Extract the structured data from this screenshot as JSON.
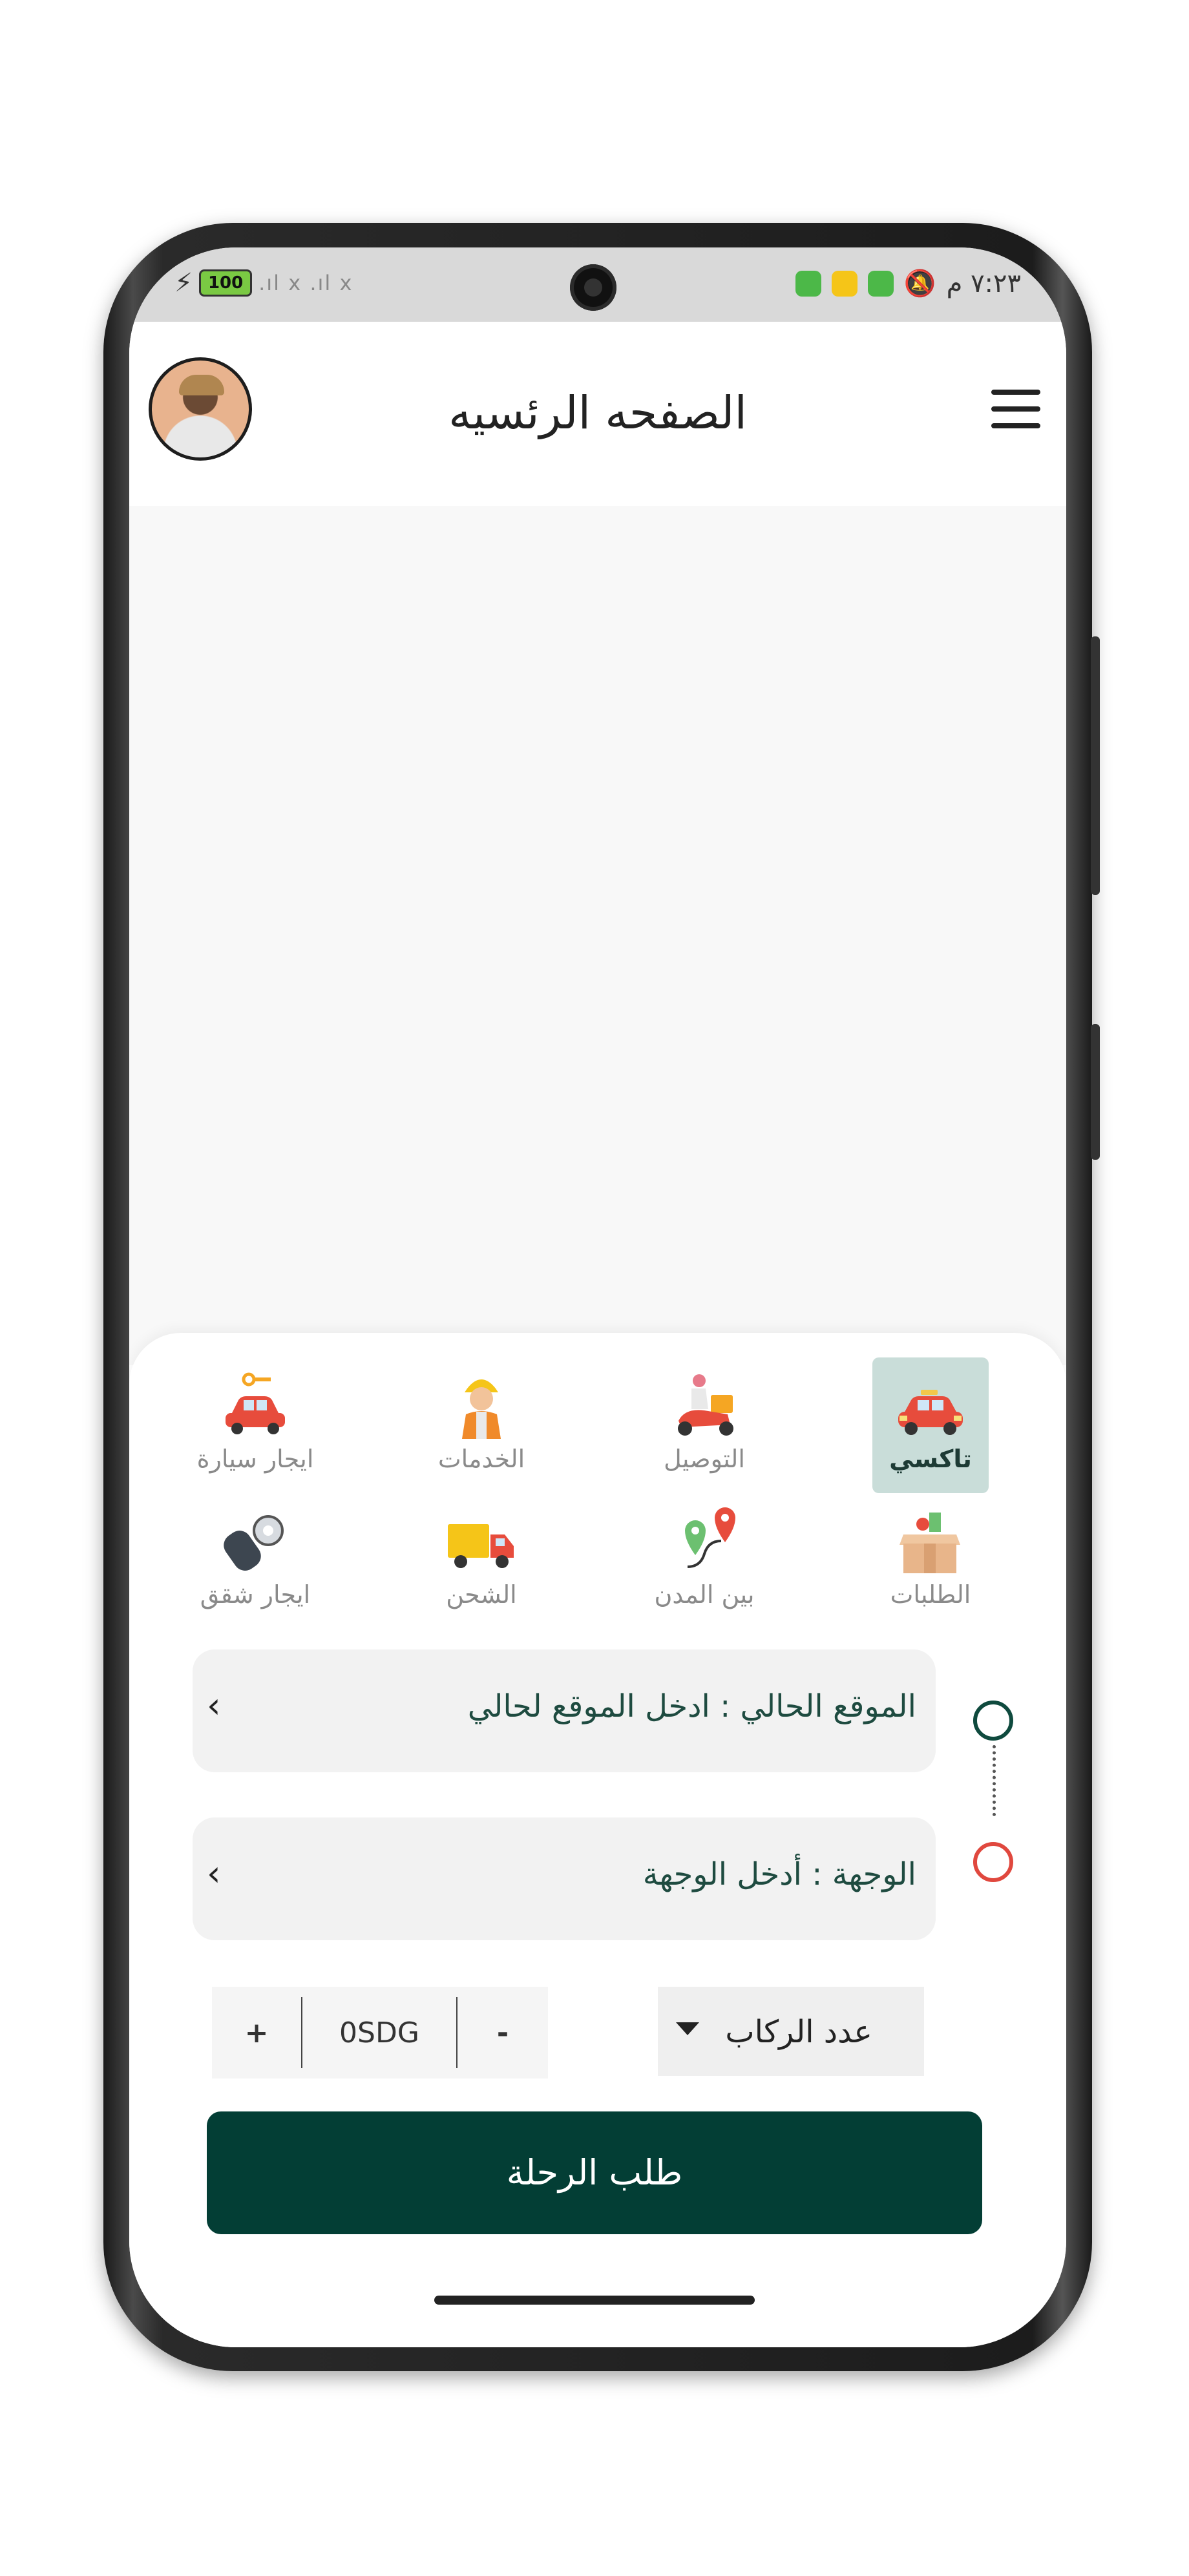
{
  "status_bar": {
    "time": "٧:٢٣ م",
    "battery": "100"
  },
  "header": {
    "title": "الصفحه الرئسيه"
  },
  "services": [
    {
      "label": "تاكسي"
    },
    {
      "label": "التوصيل"
    },
    {
      "label": "الخدمات"
    },
    {
      "label": "ايجار سيارة"
    },
    {
      "label": "الطلبات"
    },
    {
      "label": "بين المدن"
    },
    {
      "label": "الشحن"
    },
    {
      "label": "ايجار شقق"
    }
  ],
  "trip": {
    "current_location": "الموقع الحالي : ادخل الموقع لحالي",
    "destination": "الوجهة : أدخل الوجهة"
  },
  "passengers": {
    "label": "عدد الركاب"
  },
  "fare": {
    "value": "0SDG",
    "minus": "-",
    "plus": "+"
  },
  "actions": {
    "request_trip": "طلب الرحلة"
  },
  "colors": {
    "primary": "#033e35",
    "active_tab": "#c9ddd9",
    "origin_ring": "#0f4a3e",
    "destination_ring": "#e0483e"
  }
}
